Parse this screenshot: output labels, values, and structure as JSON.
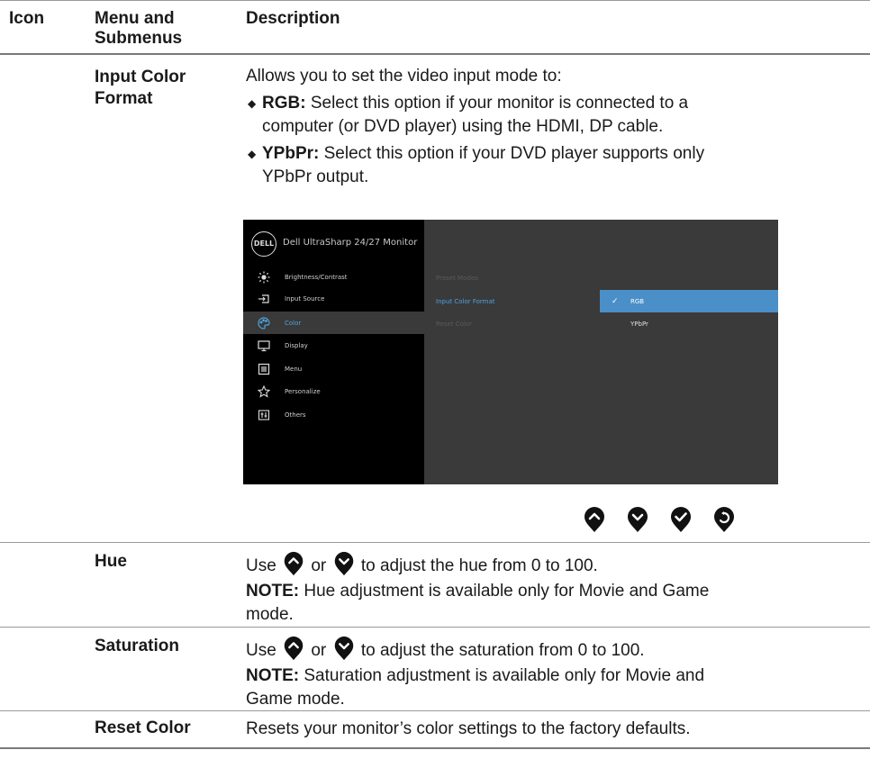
{
  "header": {
    "col_icon": "Icon",
    "col_menu_line1": "Menu and",
    "col_menu_line2": "Submenus",
    "col_desc": "Description"
  },
  "rows": {
    "input_color_format": {
      "name_line1": "Input Color",
      "name_line2": "Format",
      "intro": "Allows you to set the video input mode to:",
      "rgb_label": "RGB:",
      "rgb_text_line1": " Select this option if your monitor is connected to a",
      "rgb_text_line2": "computer (or DVD player) using the HDMI, DP cable.",
      "ypbpr_label": "YPbPr:",
      "ypbpr_text_line1": " Select this option if your DVD player supports only",
      "ypbpr_text_line2": "YPbPr output."
    },
    "hue": {
      "name": "Hue",
      "use": "Use",
      "or": "or",
      "rest": "to adjust the hue from 0 to 100.",
      "note_label": "NOTE:",
      "note_line1": " Hue adjustment is available only for Movie and Game",
      "note_line2": "mode."
    },
    "saturation": {
      "name": "Saturation",
      "use": "Use",
      "or": "or",
      "rest": "to adjust the saturation from 0 to 100.",
      "note_label": "NOTE:",
      "note_line1": " Saturation adjustment is available only for Movie and",
      "note_line2": "Game mode."
    },
    "reset_color": {
      "name": "Reset Color",
      "desc": "Resets your monitor’s color settings to the factory defaults."
    }
  },
  "osd": {
    "logo": "DELL",
    "title": "Dell UltraSharp 24/27 Monitor",
    "menu": [
      {
        "label": "Brightness/Contrast",
        "icon": "sun-icon"
      },
      {
        "label": "Input Source",
        "icon": "input-source-icon"
      },
      {
        "label": "Color",
        "icon": "palette-icon"
      },
      {
        "label": "Display",
        "icon": "monitor-icon"
      },
      {
        "label": "Menu",
        "icon": "menu-icon"
      },
      {
        "label": "Personalize",
        "icon": "star-icon"
      },
      {
        "label": "Others",
        "icon": "others-icon"
      }
    ],
    "submenu": [
      "Preset Modes",
      "Input Color Format",
      "Reset Color"
    ],
    "options": [
      "RGB",
      "YPbPr"
    ],
    "accent": "#4da3e0",
    "selected_bg": "#4b8fc9"
  },
  "nav_buttons": [
    "up-button-icon",
    "down-button-icon",
    "check-button-icon",
    "back-button-icon"
  ]
}
